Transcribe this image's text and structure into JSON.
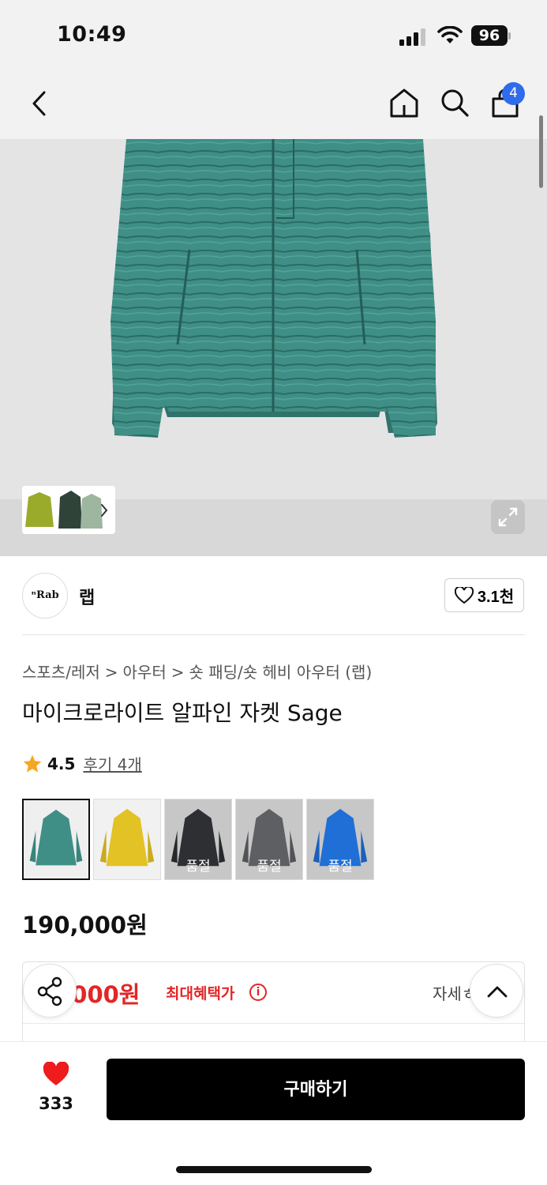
{
  "status": {
    "time": "10:49",
    "battery": "96"
  },
  "nav": {
    "cart_count": "4"
  },
  "brand": {
    "logo_text": "ⁿRab",
    "name": "랩",
    "likes": "3.1천"
  },
  "breadcrumb": [
    "스포츠/레저",
    "아우터",
    "숏 패딩/숏 헤비 아우터 (랩)"
  ],
  "product": {
    "title": "마이크로라이트 알파인 자켓 Sage",
    "rating": "4.5",
    "reviews": "후기 4개",
    "price": "190,000원"
  },
  "swatches": [
    {
      "color": "#3f8f86",
      "sold_out": false,
      "selected": true,
      "label": ""
    },
    {
      "color": "#e2c224",
      "sold_out": false,
      "selected": false,
      "label": ""
    },
    {
      "color": "#2d2f33",
      "sold_out": true,
      "selected": false,
      "label": "품절"
    },
    {
      "color": "#5e5f62",
      "sold_out": true,
      "selected": false,
      "label": "품절"
    },
    {
      "color": "#1f6fd6",
      "sold_out": true,
      "selected": false,
      "label": "품절"
    }
  ],
  "benefit": {
    "price": "),000원",
    "label": "최대혜택가",
    "info": "i",
    "detail": "자세ㅎ"
  },
  "bottom": {
    "wish_count": "333",
    "buy_label": "구매하기"
  },
  "colors": {
    "accent_red": "#e32626",
    "badge_blue": "#2f6bea",
    "jacket_teal": "#3f8f86"
  }
}
